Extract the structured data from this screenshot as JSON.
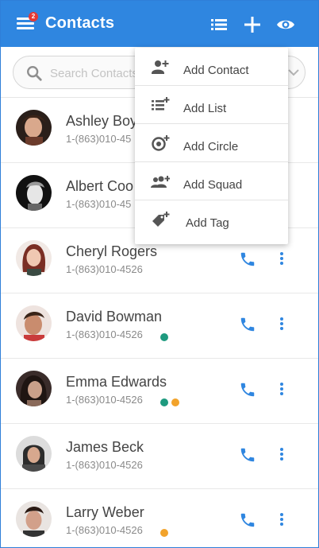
{
  "header": {
    "title": "Contacts",
    "badge_count": "2",
    "accent_color": "#2f86e0"
  },
  "search": {
    "placeholder": "Search Contacts"
  },
  "contacts": [
    {
      "name": "Ashley Boy",
      "phone": "1-(863)010-45",
      "status": []
    },
    {
      "name": "Albert Coo",
      "phone": "1-(863)010-45",
      "status": []
    },
    {
      "name": "Cheryl Rogers",
      "phone": "1-(863)010-4526",
      "status": []
    },
    {
      "name": "David Bowman",
      "phone": "1-(863)010-4526",
      "status": [
        "#1e9a7f"
      ]
    },
    {
      "name": "Emma Edwards",
      "phone": "1-(863)010-4526",
      "status": [
        "#1e9a7f",
        "#f2a32b"
      ]
    },
    {
      "name": "James Beck",
      "phone": "1-(863)010-4526",
      "status": []
    },
    {
      "name": "Larry Weber",
      "phone": "1-(863)010-4526",
      "status": [
        "#f2a32b"
      ]
    }
  ],
  "add_menu": {
    "items": [
      {
        "label": "Add Contact",
        "icon": "add-contact-icon"
      },
      {
        "label": "Add List",
        "icon": "add-list-icon"
      },
      {
        "label": "Add Circle",
        "icon": "add-circle-icon"
      },
      {
        "label": "Add Squad",
        "icon": "add-squad-icon"
      },
      {
        "label": "Add Tag",
        "icon": "add-tag-icon"
      }
    ]
  }
}
